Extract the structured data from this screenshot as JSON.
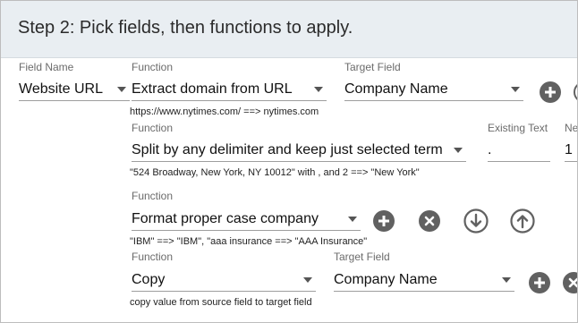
{
  "header": {
    "title": "Step 2: Pick fields, then functions to apply."
  },
  "row1": {
    "field_name_label": "Field Name",
    "field_name_value": "Website URL",
    "function_label": "Function",
    "function_value": "Extract domain from URL",
    "target_label": "Target Field",
    "target_value": "Company Name",
    "example": "https://www.nytimes.com/ ==> nytimes.com"
  },
  "row2": {
    "function_label": "Function",
    "function_value": "Split by any delimiter and keep just selected term",
    "existing_text_label": "Existing Text",
    "existing_text_value": ".",
    "next_label": "Ne",
    "next_value": "1",
    "example": "\"524 Broadway, New York, NY 10012\" with , and 2 ==> \"New York\""
  },
  "row3": {
    "function_label": "Function",
    "function_value": "Format proper case company",
    "example": "\"IBM\" ==> \"IBM\", \"aaa insurance ==> \"AAA Insurance\""
  },
  "row4": {
    "function_label": "Function",
    "function_value": "Copy",
    "target_label": "Target Field",
    "target_value": "Company Name",
    "example": "copy value from source field to target field"
  },
  "icons": {
    "add": "plus-icon",
    "remove": "close-icon",
    "move_down": "arrow-down-icon",
    "move_up": "arrow-up-icon"
  },
  "colors": {
    "header_bg": "#e9eef2",
    "icon_fill": "#616161",
    "underline": "#9e9e9e"
  }
}
